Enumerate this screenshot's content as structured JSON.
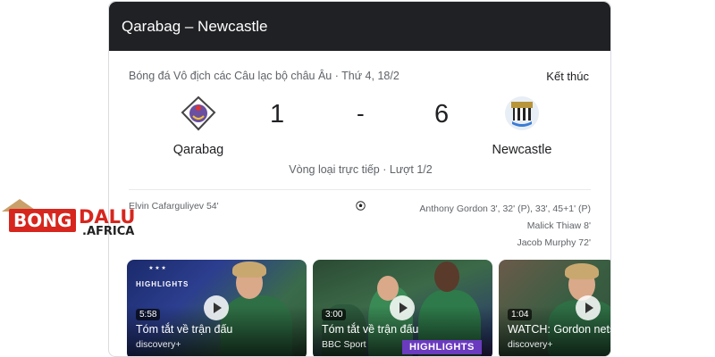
{
  "header": {
    "title": "Qarabag – Newcastle"
  },
  "match": {
    "competition_date": "Bóng đá Vô địch các Câu lạc bộ châu Âu · Thứ 4, 18/2",
    "status": "Kết thúc",
    "home": {
      "name": "Qarabag",
      "score": "1"
    },
    "away": {
      "name": "Newcastle",
      "score": "6"
    },
    "separator": "-",
    "round": "Vòng loại trực tiếp · Lượt 1/2"
  },
  "scorers": {
    "home": [
      "Elvin Cafarguliyev 54'"
    ],
    "away": [
      "Anthony Gordon 3', 32' (P), 33', 45+1' (P)",
      "Malick Thiaw 8'",
      "Jacob Murphy 72'"
    ]
  },
  "videos": [
    {
      "duration": "5:58",
      "title": "Tóm tắt về trận đấu",
      "source": "discovery+",
      "badge": "HIGHLIGHTS"
    },
    {
      "duration": "3:00",
      "title": "Tóm tắt về trận đấu",
      "source": "BBC Sport",
      "banner": "HIGHLIGHTS"
    },
    {
      "duration": "1:04",
      "title": "WATCH: Gordon nets",
      "source": "discovery+"
    }
  ],
  "watermark": {
    "bong": "BONG",
    "dalu": "DALU",
    "africa": ".AFRICA"
  },
  "colors": {
    "header_bg": "#202124",
    "watermark_red": "#d7261e",
    "highlights_purple": "#6a3bbf"
  },
  "icons": [
    "qarabag-crest-icon",
    "newcastle-crest-icon",
    "soccer-ball-icon",
    "play-icon"
  ]
}
